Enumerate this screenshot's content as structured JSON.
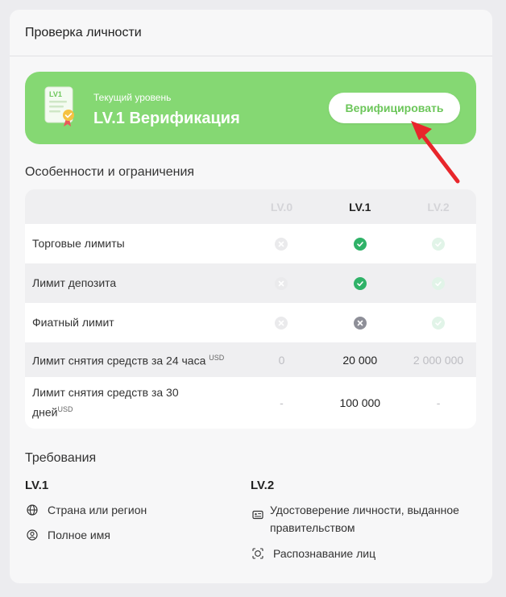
{
  "card": {
    "title": "Проверка личности"
  },
  "banner": {
    "caption": "Текущий уровень",
    "level_title": "LV.1 Верификация",
    "doc_icon_text": "LV1",
    "verify_label": "Верифицировать"
  },
  "features": {
    "title": "Особенности и ограничения",
    "headers": [
      "LV.0",
      "LV.1",
      "LV.2"
    ],
    "rows": [
      {
        "label": "Торговые лимиты",
        "lv0": "x-faint",
        "lv1": "check",
        "lv2": "check-faint"
      },
      {
        "label": "Лимит депозита",
        "lv0": "x-faint",
        "lv1": "check",
        "lv2": "check-faint"
      },
      {
        "label": "Фиатный лимит",
        "lv0": "x-faint",
        "lv1": "x",
        "lv2": "check-faint"
      },
      {
        "label": "Лимит снятия средств за 24 часа",
        "unit": "USD",
        "lv0": "0",
        "lv1": "20 000",
        "lv2": "2 000 000"
      },
      {
        "label_line1": "Лимит снятия средств за 30",
        "label_line2": "дней",
        "unit": "USD",
        "lv0": "-",
        "lv1": "100 000",
        "lv2": "-"
      }
    ]
  },
  "requirements": {
    "title": "Требования",
    "lv1": {
      "head": "LV.1",
      "items": [
        {
          "icon": "globe-icon",
          "label": "Страна или регион"
        },
        {
          "icon": "user-icon",
          "label": "Полное имя"
        }
      ]
    },
    "lv2": {
      "head": "LV.2",
      "items": [
        {
          "icon": "id-card-icon",
          "line1": "Удостоверение личности, выданное",
          "line2": "правительством"
        },
        {
          "icon": "face-scan-icon",
          "label": "Распознавание лиц"
        }
      ]
    }
  },
  "colors": {
    "banner": "#85d873",
    "accent_green": "#2fb268",
    "button_text": "#6cc65a",
    "arrow": "#e8262b"
  }
}
